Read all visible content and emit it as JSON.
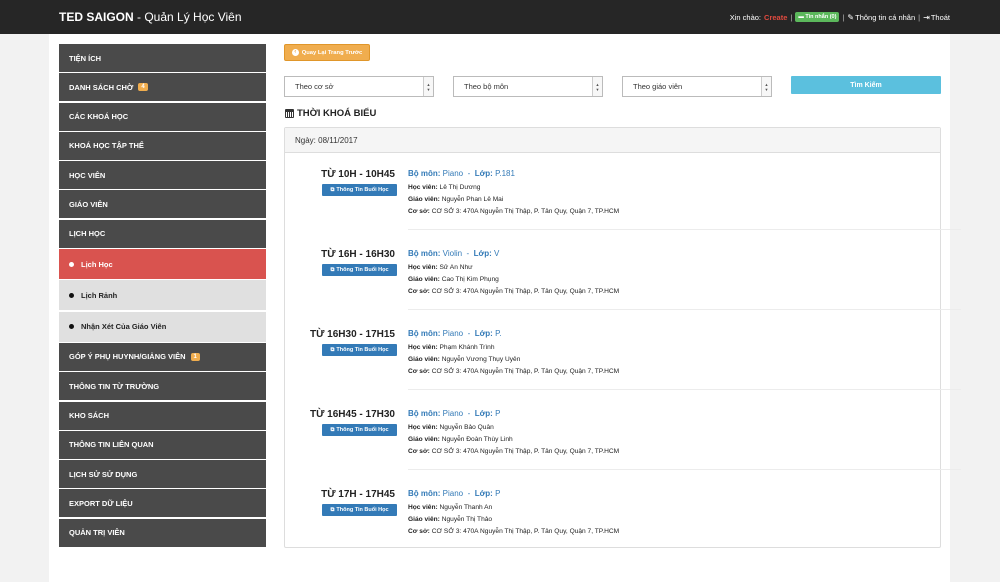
{
  "header": {
    "brand": "TED SAIGON",
    "subtitle": " - Quản Lý Học Viên",
    "greeting": "Xin chào:",
    "user": "Create",
    "messages": "Tin nhắn (0)",
    "profile": "Thông tin cá nhân",
    "logout": "Thoát",
    "separator": "|"
  },
  "sidebar": {
    "items": [
      {
        "label": "Tiện ích"
      },
      {
        "label": "Danh sách chờ",
        "badge": "4"
      },
      {
        "label": "Các khoá học"
      },
      {
        "label": "Khoá học tập thể"
      },
      {
        "label": "Học viên"
      },
      {
        "label": "Giáo viên"
      },
      {
        "label": "Lịch học"
      },
      {
        "label": "Góp ý phụ huynh/giảng viên",
        "badge": "1"
      },
      {
        "label": "Thông tin từ trường"
      },
      {
        "label": "Kho sách"
      },
      {
        "label": "Thông tin liên quan"
      },
      {
        "label": "Lịch sử sử dụng"
      },
      {
        "label": "Export dữ liệu"
      },
      {
        "label": "Quản trị viên"
      }
    ],
    "subitems": [
      {
        "label": "Lịch Học",
        "active": true
      },
      {
        "label": "Lịch Rảnh",
        "active": false
      },
      {
        "label": "Nhận Xét Của Giáo Viên",
        "active": false
      }
    ]
  },
  "toolbar": {
    "back_label": "Quay Lại Trang Trước",
    "filter_location": "Theo cơ sở",
    "filter_subject": "Theo bộ môn",
    "filter_teacher": "Theo giáo viên",
    "search_label": "Tìm Kiếm"
  },
  "schedule": {
    "title": "THỜI KHOÁ BIỂU",
    "date_label": "Ngày: 08/11/2017",
    "info_button": "Thông Tin Buổi Học",
    "labels": {
      "subject": "Bộ môn:",
      "class": "Lớp:",
      "student": "Học viên:",
      "teacher": "Giáo viên:",
      "location": "Cơ sở:"
    },
    "entries": [
      {
        "time": "TỪ 10H - 10H45",
        "subject": "Piano",
        "class": "P.181",
        "student": "Lê Thị Dương",
        "teacher": "Nguyễn Phan Lê Mai",
        "location": "CƠ SỞ 3: 470A Nguyễn Thị Thập, P. Tân Quy, Quận 7, TP.HCM"
      },
      {
        "time": "TỪ 16H - 16H30",
        "subject": "Violin",
        "class": "V",
        "student": "Sử An Như",
        "teacher": "Cao Thị Kim Phụng",
        "location": "CƠ SỞ 3: 470A Nguyễn Thị Thập, P. Tân Quy, Quận 7, TP.HCM"
      },
      {
        "time": "TỪ 16H30 - 17H15",
        "subject": "Piano",
        "class": "P.",
        "student": "Phạm Khánh Trình",
        "teacher": "Nguyễn Vương Thụy Uyên",
        "location": "CƠ SỞ 3: 470A Nguyễn Thị Thập, P. Tân Quy, Quận 7, TP.HCM"
      },
      {
        "time": "TỪ 16H45 - 17H30",
        "subject": "Piano",
        "class": "P",
        "student": "Nguyễn Bảo Quân",
        "teacher": "Nguyễn Đoàn Thùy Linh",
        "location": "CƠ SỞ 3: 470A Nguyễn Thị Thập, P. Tân Quy, Quận 7, TP.HCM"
      },
      {
        "time": "TỪ 17H - 17H45",
        "subject": "Piano",
        "class": "P",
        "student": "Nguyễn Thanh An",
        "teacher": "Nguyễn Thị Thảo",
        "location": "CƠ SỞ 3: 470A Nguyễn Thị Thập, P. Tân Quy, Quận 7, TP.HCM"
      }
    ]
  }
}
